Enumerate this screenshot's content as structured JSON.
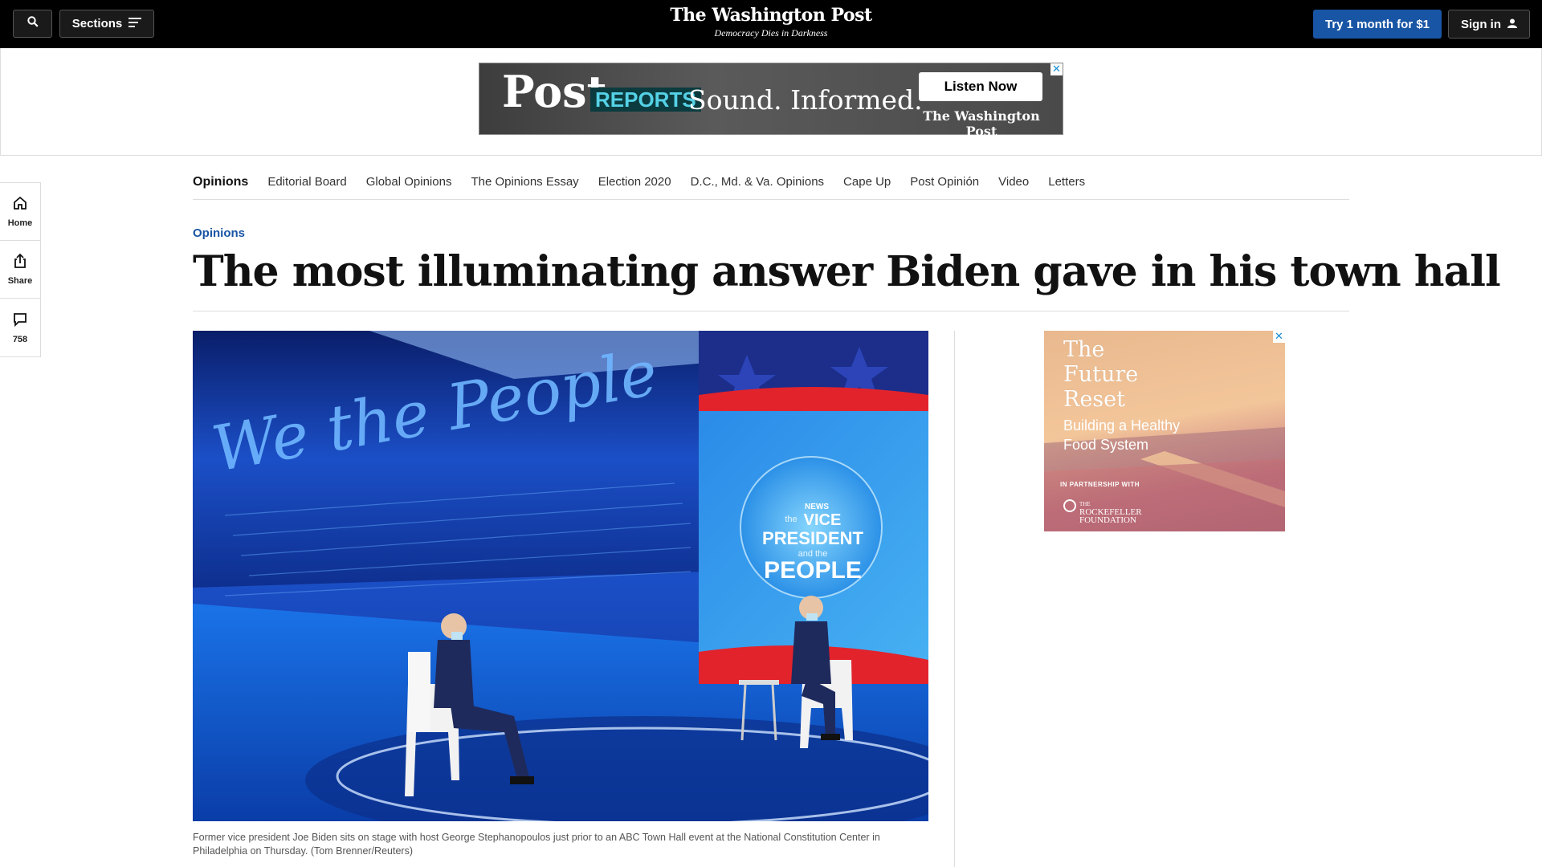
{
  "topbar": {
    "sections_label": "Sections",
    "logo_name": "The Washington Post",
    "logo_tagline": "Democracy Dies in Darkness",
    "try_label": "Try 1 month for $1",
    "sign_in_label": "Sign in"
  },
  "top_ad": {
    "post": "Post",
    "reports": "REPORTS",
    "sound": "Sound. Informed.",
    "listen": "Listen Now",
    "brand": "The Washington Post"
  },
  "left_rail": {
    "home": "Home",
    "share": "Share",
    "comments": "758"
  },
  "opinions_nav": [
    "Opinions",
    "Editorial Board",
    "Global Opinions",
    "The Opinions Essay",
    "Election 2020",
    "D.C., Md. & Va. Opinions",
    "Cape Up",
    "Post Opinión",
    "Video",
    "Letters"
  ],
  "article": {
    "kicker": "Opinions",
    "headline": "The most illuminating answer Biden gave in his town hall",
    "caption": "Former vice president Joe Biden sits on stage with host George Stephanopoulos just prior to an ABC Town Hall event at the National Constitution Center in Philadelphia on Thursday. (Tom Brenner/Reuters)"
  },
  "photo": {
    "script_text": "We the People",
    "screen_small": "the",
    "screen_line1": "VICE",
    "screen_line2": "PRESIDENT",
    "screen_small2": "and the",
    "screen_line3": "PEOPLE",
    "screen_network": "NEWS"
  },
  "right_ad": {
    "title_1": "The",
    "title_2": "Future",
    "title_3": "Reset",
    "sub_1": "Building a Healthy",
    "sub_2": "Food System",
    "partner": "IN PARTNERSHIP WITH",
    "foundation_1": "ROCKEFELLER",
    "foundation_2": "FOUNDATION",
    "foundation_pre": "THE"
  },
  "colors": {
    "topbar": "#000000",
    "accent_blue": "#1955a5",
    "photo_stage": "#0c2a7a"
  }
}
